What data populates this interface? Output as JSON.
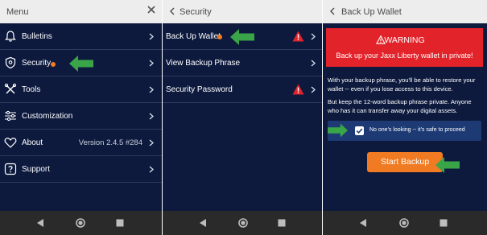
{
  "menu": {
    "title": "Menu",
    "items": [
      {
        "label": "Bulletins"
      },
      {
        "label": "Security"
      },
      {
        "label": "Tools"
      },
      {
        "label": "Customization"
      },
      {
        "label": "About",
        "version": "Version 2.4.5 #284"
      },
      {
        "label": "Support"
      }
    ]
  },
  "security": {
    "title": "Security",
    "items": [
      {
        "label": "Back Up Wallet"
      },
      {
        "label": "View Backup Phrase"
      },
      {
        "label": "Security Password"
      }
    ]
  },
  "backup": {
    "title": "Back Up Wallet",
    "warning_title": "WARNING",
    "warning_message": "Back up your Jaxx Liberty wallet in private!",
    "paragraph1": "With your backup phrase, you'll be able to restore your wallet -- even if you lose access to this device.",
    "paragraph2": "But keep the 12-word backup phrase private. Anyone who has it can transfer away your digital assets.",
    "confirm_label": "No one's looking -- it's safe to proceed",
    "confirm_checked": true,
    "start_button": "Start Backup"
  },
  "colors": {
    "background": "#0d1a3e",
    "header": "#ededed",
    "accent": "#f07b22",
    "warning": "#e3232a",
    "annotation_arrow": "#3aa548"
  },
  "icons": {
    "close": "close-icon",
    "back": "back-arrow-icon",
    "chevron": "chevron-right-icon",
    "warning": "warning-triangle-icon",
    "nav_back": "nav-back-icon",
    "nav_home": "nav-home-icon",
    "nav_recents": "nav-recents-icon"
  }
}
